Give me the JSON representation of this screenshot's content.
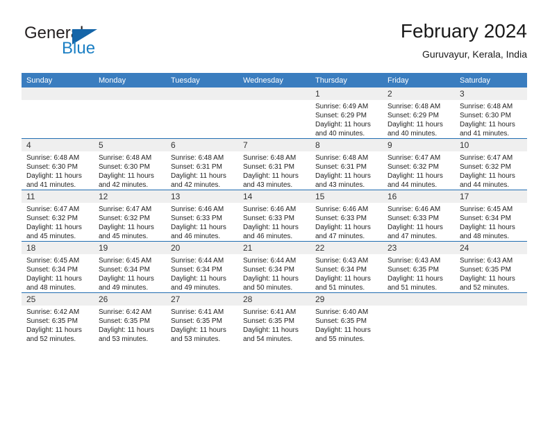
{
  "brand": {
    "name_part1": "General",
    "name_part2": "Blue",
    "mark": "triangle-logo"
  },
  "header": {
    "title": "February 2024",
    "subtitle": "Guruvayur, Kerala, India"
  },
  "colors": {
    "header_blue": "#3a7dbf",
    "row_divider_blue": "#1f6cb0",
    "daynum_band": "#efefef",
    "brand_blue": "#1b7fc4"
  },
  "weekday_headers": [
    "Sunday",
    "Monday",
    "Tuesday",
    "Wednesday",
    "Thursday",
    "Friday",
    "Saturday"
  ],
  "weeks": [
    [
      {
        "day": "",
        "lines": []
      },
      {
        "day": "",
        "lines": []
      },
      {
        "day": "",
        "lines": []
      },
      {
        "day": "",
        "lines": []
      },
      {
        "day": "1",
        "lines": [
          "Sunrise: 6:49 AM",
          "Sunset: 6:29 PM",
          "Daylight: 11 hours",
          "and 40 minutes."
        ]
      },
      {
        "day": "2",
        "lines": [
          "Sunrise: 6:48 AM",
          "Sunset: 6:29 PM",
          "Daylight: 11 hours",
          "and 40 minutes."
        ]
      },
      {
        "day": "3",
        "lines": [
          "Sunrise: 6:48 AM",
          "Sunset: 6:30 PM",
          "Daylight: 11 hours",
          "and 41 minutes."
        ]
      }
    ],
    [
      {
        "day": "4",
        "lines": [
          "Sunrise: 6:48 AM",
          "Sunset: 6:30 PM",
          "Daylight: 11 hours",
          "and 41 minutes."
        ]
      },
      {
        "day": "5",
        "lines": [
          "Sunrise: 6:48 AM",
          "Sunset: 6:30 PM",
          "Daylight: 11 hours",
          "and 42 minutes."
        ]
      },
      {
        "day": "6",
        "lines": [
          "Sunrise: 6:48 AM",
          "Sunset: 6:31 PM",
          "Daylight: 11 hours",
          "and 42 minutes."
        ]
      },
      {
        "day": "7",
        "lines": [
          "Sunrise: 6:48 AM",
          "Sunset: 6:31 PM",
          "Daylight: 11 hours",
          "and 43 minutes."
        ]
      },
      {
        "day": "8",
        "lines": [
          "Sunrise: 6:48 AM",
          "Sunset: 6:31 PM",
          "Daylight: 11 hours",
          "and 43 minutes."
        ]
      },
      {
        "day": "9",
        "lines": [
          "Sunrise: 6:47 AM",
          "Sunset: 6:32 PM",
          "Daylight: 11 hours",
          "and 44 minutes."
        ]
      },
      {
        "day": "10",
        "lines": [
          "Sunrise: 6:47 AM",
          "Sunset: 6:32 PM",
          "Daylight: 11 hours",
          "and 44 minutes."
        ]
      }
    ],
    [
      {
        "day": "11",
        "lines": [
          "Sunrise: 6:47 AM",
          "Sunset: 6:32 PM",
          "Daylight: 11 hours",
          "and 45 minutes."
        ]
      },
      {
        "day": "12",
        "lines": [
          "Sunrise: 6:47 AM",
          "Sunset: 6:32 PM",
          "Daylight: 11 hours",
          "and 45 minutes."
        ]
      },
      {
        "day": "13",
        "lines": [
          "Sunrise: 6:46 AM",
          "Sunset: 6:33 PM",
          "Daylight: 11 hours",
          "and 46 minutes."
        ]
      },
      {
        "day": "14",
        "lines": [
          "Sunrise: 6:46 AM",
          "Sunset: 6:33 PM",
          "Daylight: 11 hours",
          "and 46 minutes."
        ]
      },
      {
        "day": "15",
        "lines": [
          "Sunrise: 6:46 AM",
          "Sunset: 6:33 PM",
          "Daylight: 11 hours",
          "and 47 minutes."
        ]
      },
      {
        "day": "16",
        "lines": [
          "Sunrise: 6:46 AM",
          "Sunset: 6:33 PM",
          "Daylight: 11 hours",
          "and 47 minutes."
        ]
      },
      {
        "day": "17",
        "lines": [
          "Sunrise: 6:45 AM",
          "Sunset: 6:34 PM",
          "Daylight: 11 hours",
          "and 48 minutes."
        ]
      }
    ],
    [
      {
        "day": "18",
        "lines": [
          "Sunrise: 6:45 AM",
          "Sunset: 6:34 PM",
          "Daylight: 11 hours",
          "and 48 minutes."
        ]
      },
      {
        "day": "19",
        "lines": [
          "Sunrise: 6:45 AM",
          "Sunset: 6:34 PM",
          "Daylight: 11 hours",
          "and 49 minutes."
        ]
      },
      {
        "day": "20",
        "lines": [
          "Sunrise: 6:44 AM",
          "Sunset: 6:34 PM",
          "Daylight: 11 hours",
          "and 49 minutes."
        ]
      },
      {
        "day": "21",
        "lines": [
          "Sunrise: 6:44 AM",
          "Sunset: 6:34 PM",
          "Daylight: 11 hours",
          "and 50 minutes."
        ]
      },
      {
        "day": "22",
        "lines": [
          "Sunrise: 6:43 AM",
          "Sunset: 6:34 PM",
          "Daylight: 11 hours",
          "and 51 minutes."
        ]
      },
      {
        "day": "23",
        "lines": [
          "Sunrise: 6:43 AM",
          "Sunset: 6:35 PM",
          "Daylight: 11 hours",
          "and 51 minutes."
        ]
      },
      {
        "day": "24",
        "lines": [
          "Sunrise: 6:43 AM",
          "Sunset: 6:35 PM",
          "Daylight: 11 hours",
          "and 52 minutes."
        ]
      }
    ],
    [
      {
        "day": "25",
        "lines": [
          "Sunrise: 6:42 AM",
          "Sunset: 6:35 PM",
          "Daylight: 11 hours",
          "and 52 minutes."
        ]
      },
      {
        "day": "26",
        "lines": [
          "Sunrise: 6:42 AM",
          "Sunset: 6:35 PM",
          "Daylight: 11 hours",
          "and 53 minutes."
        ]
      },
      {
        "day": "27",
        "lines": [
          "Sunrise: 6:41 AM",
          "Sunset: 6:35 PM",
          "Daylight: 11 hours",
          "and 53 minutes."
        ]
      },
      {
        "day": "28",
        "lines": [
          "Sunrise: 6:41 AM",
          "Sunset: 6:35 PM",
          "Daylight: 11 hours",
          "and 54 minutes."
        ]
      },
      {
        "day": "29",
        "lines": [
          "Sunrise: 6:40 AM",
          "Sunset: 6:35 PM",
          "Daylight: 11 hours",
          "and 55 minutes."
        ]
      },
      {
        "day": "",
        "lines": []
      },
      {
        "day": "",
        "lines": []
      }
    ]
  ]
}
